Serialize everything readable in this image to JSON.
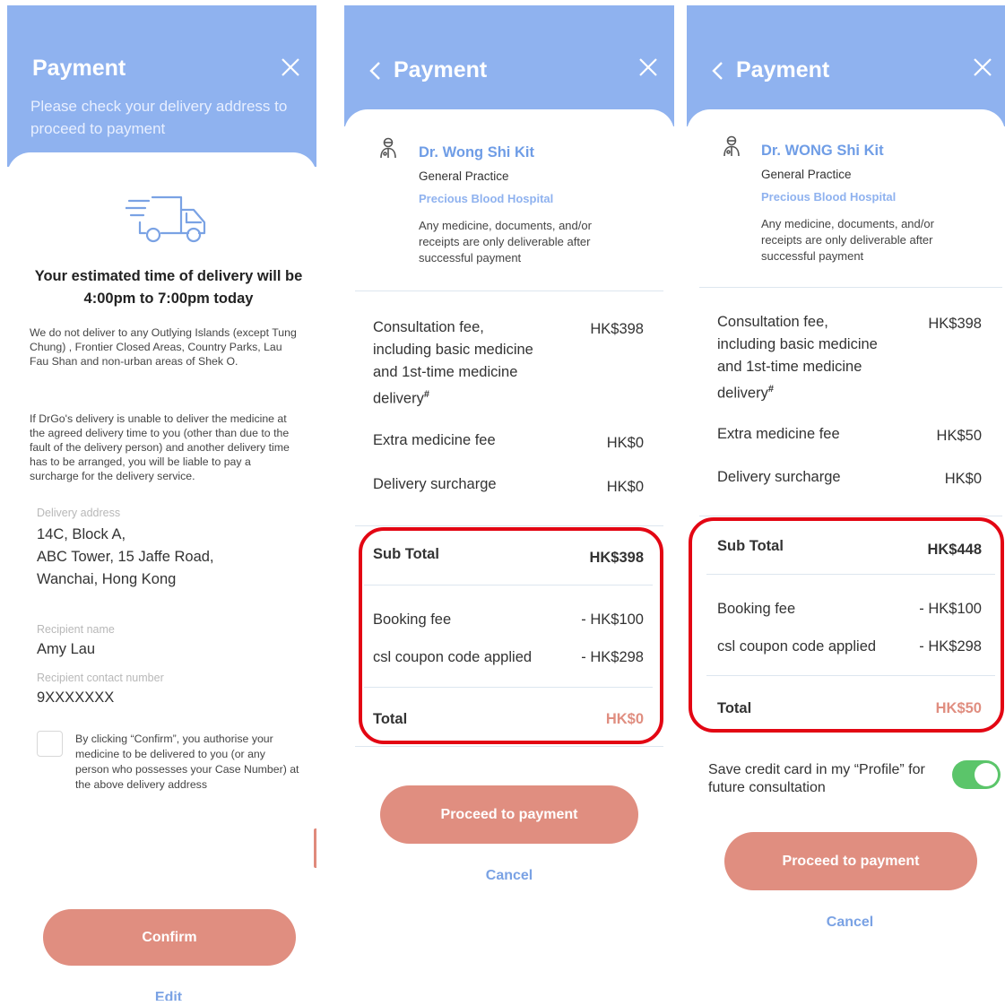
{
  "screen1": {
    "title": "Payment",
    "subtitle": "Please check your delivery address to proceed to payment",
    "eta": "Your estimated time of delivery will be 4:00pm to 7:00pm today",
    "notice1": "We do not deliver to any Outlying Islands (except Tung Chung) , Frontier Closed Areas, Country Parks, Lau Fau Shan and non-urban areas of Shek O.",
    "notice2": "If DrGo's delivery is unable to deliver the medicine at the agreed delivery time to you (other than due to the fault of the delivery person) and another delivery time has to be arranged, you will be liable to pay a surcharge for the delivery service.",
    "address_label": "Delivery address",
    "address_line1": "14C, Block A,",
    "address_line2": "ABC Tower, 15 Jaffe Road,",
    "address_line3": "Wanchai, Hong Kong",
    "recipient_label": "Recipient name",
    "recipient_value": "Amy Lau",
    "contact_label": "Recipient contact number",
    "contact_value": "9XXXXXXX",
    "consent": "By clicking “Confirm”, you authorise your medicine to be delivered to you (or any person who possesses your Case Number) at the above delivery address",
    "confirm_label": "Confirm",
    "edit_label": "Edit"
  },
  "screen2": {
    "title": "Payment",
    "doctor_name": "Dr. Wong Shi Kit",
    "specialty": "General Practice",
    "hospital": "Precious Blood Hospital",
    "note": "Any medicine, documents, and/or receipts are only deliverable after successful payment",
    "consult_line1": "Consultation fee,",
    "consult_line2": "including basic medicine",
    "consult_line3": "and 1st-time medicine",
    "consult_line4": "delivery",
    "hash": "#",
    "consult_value": "HK$398",
    "extra_label": "Extra medicine fee",
    "extra_value": "HK$0",
    "surcharge_label": "Delivery surcharge",
    "surcharge_value": "HK$0",
    "subtotal_label": "Sub Total",
    "subtotal_value": "HK$398",
    "booking_label": "Booking fee",
    "booking_value": "- HK$100",
    "coupon_label": "csl coupon code applied",
    "coupon_value": "- HK$298",
    "total_label": "Total",
    "total_value": "HK$0",
    "proceed_label": "Proceed to payment",
    "cancel_label": "Cancel"
  },
  "screen3": {
    "title": "Payment",
    "doctor_name": "Dr. WONG Shi Kit",
    "specialty": "General Practice",
    "hospital": "Precious Blood Hospital",
    "note": "Any medicine, documents, and/or receipts are only deliverable after successful payment",
    "consult_line1": "Consultation fee,",
    "consult_line2": "including basic medicine",
    "consult_line3": "and 1st-time medicine",
    "consult_line4": "delivery",
    "hash": "#",
    "consult_value": "HK$398",
    "extra_label": "Extra medicine fee",
    "extra_value": "HK$50",
    "surcharge_label": "Delivery surcharge",
    "surcharge_value": "HK$0",
    "subtotal_label": "Sub Total",
    "subtotal_value": "HK$448",
    "booking_label": "Booking fee",
    "booking_value": "- HK$100",
    "coupon_label": "csl coupon code applied",
    "coupon_value": "- HK$298",
    "total_label": "Total",
    "total_value": "HK$50",
    "save_card_label": "Save credit card in my “Profile” for future consultation",
    "save_card_enabled": true,
    "proceed_label": "Proceed to payment",
    "cancel_label": "Cancel"
  },
  "colors": {
    "header": "#8fb2ef",
    "accent_button": "#e08e80",
    "link": "#7aa2e4",
    "highlight": "#e30613",
    "toggle_on": "#5bc56a",
    "total_red": "#e08e80"
  },
  "icons": [
    "close-icon",
    "back-icon",
    "truck-icon",
    "doctor-icon"
  ]
}
